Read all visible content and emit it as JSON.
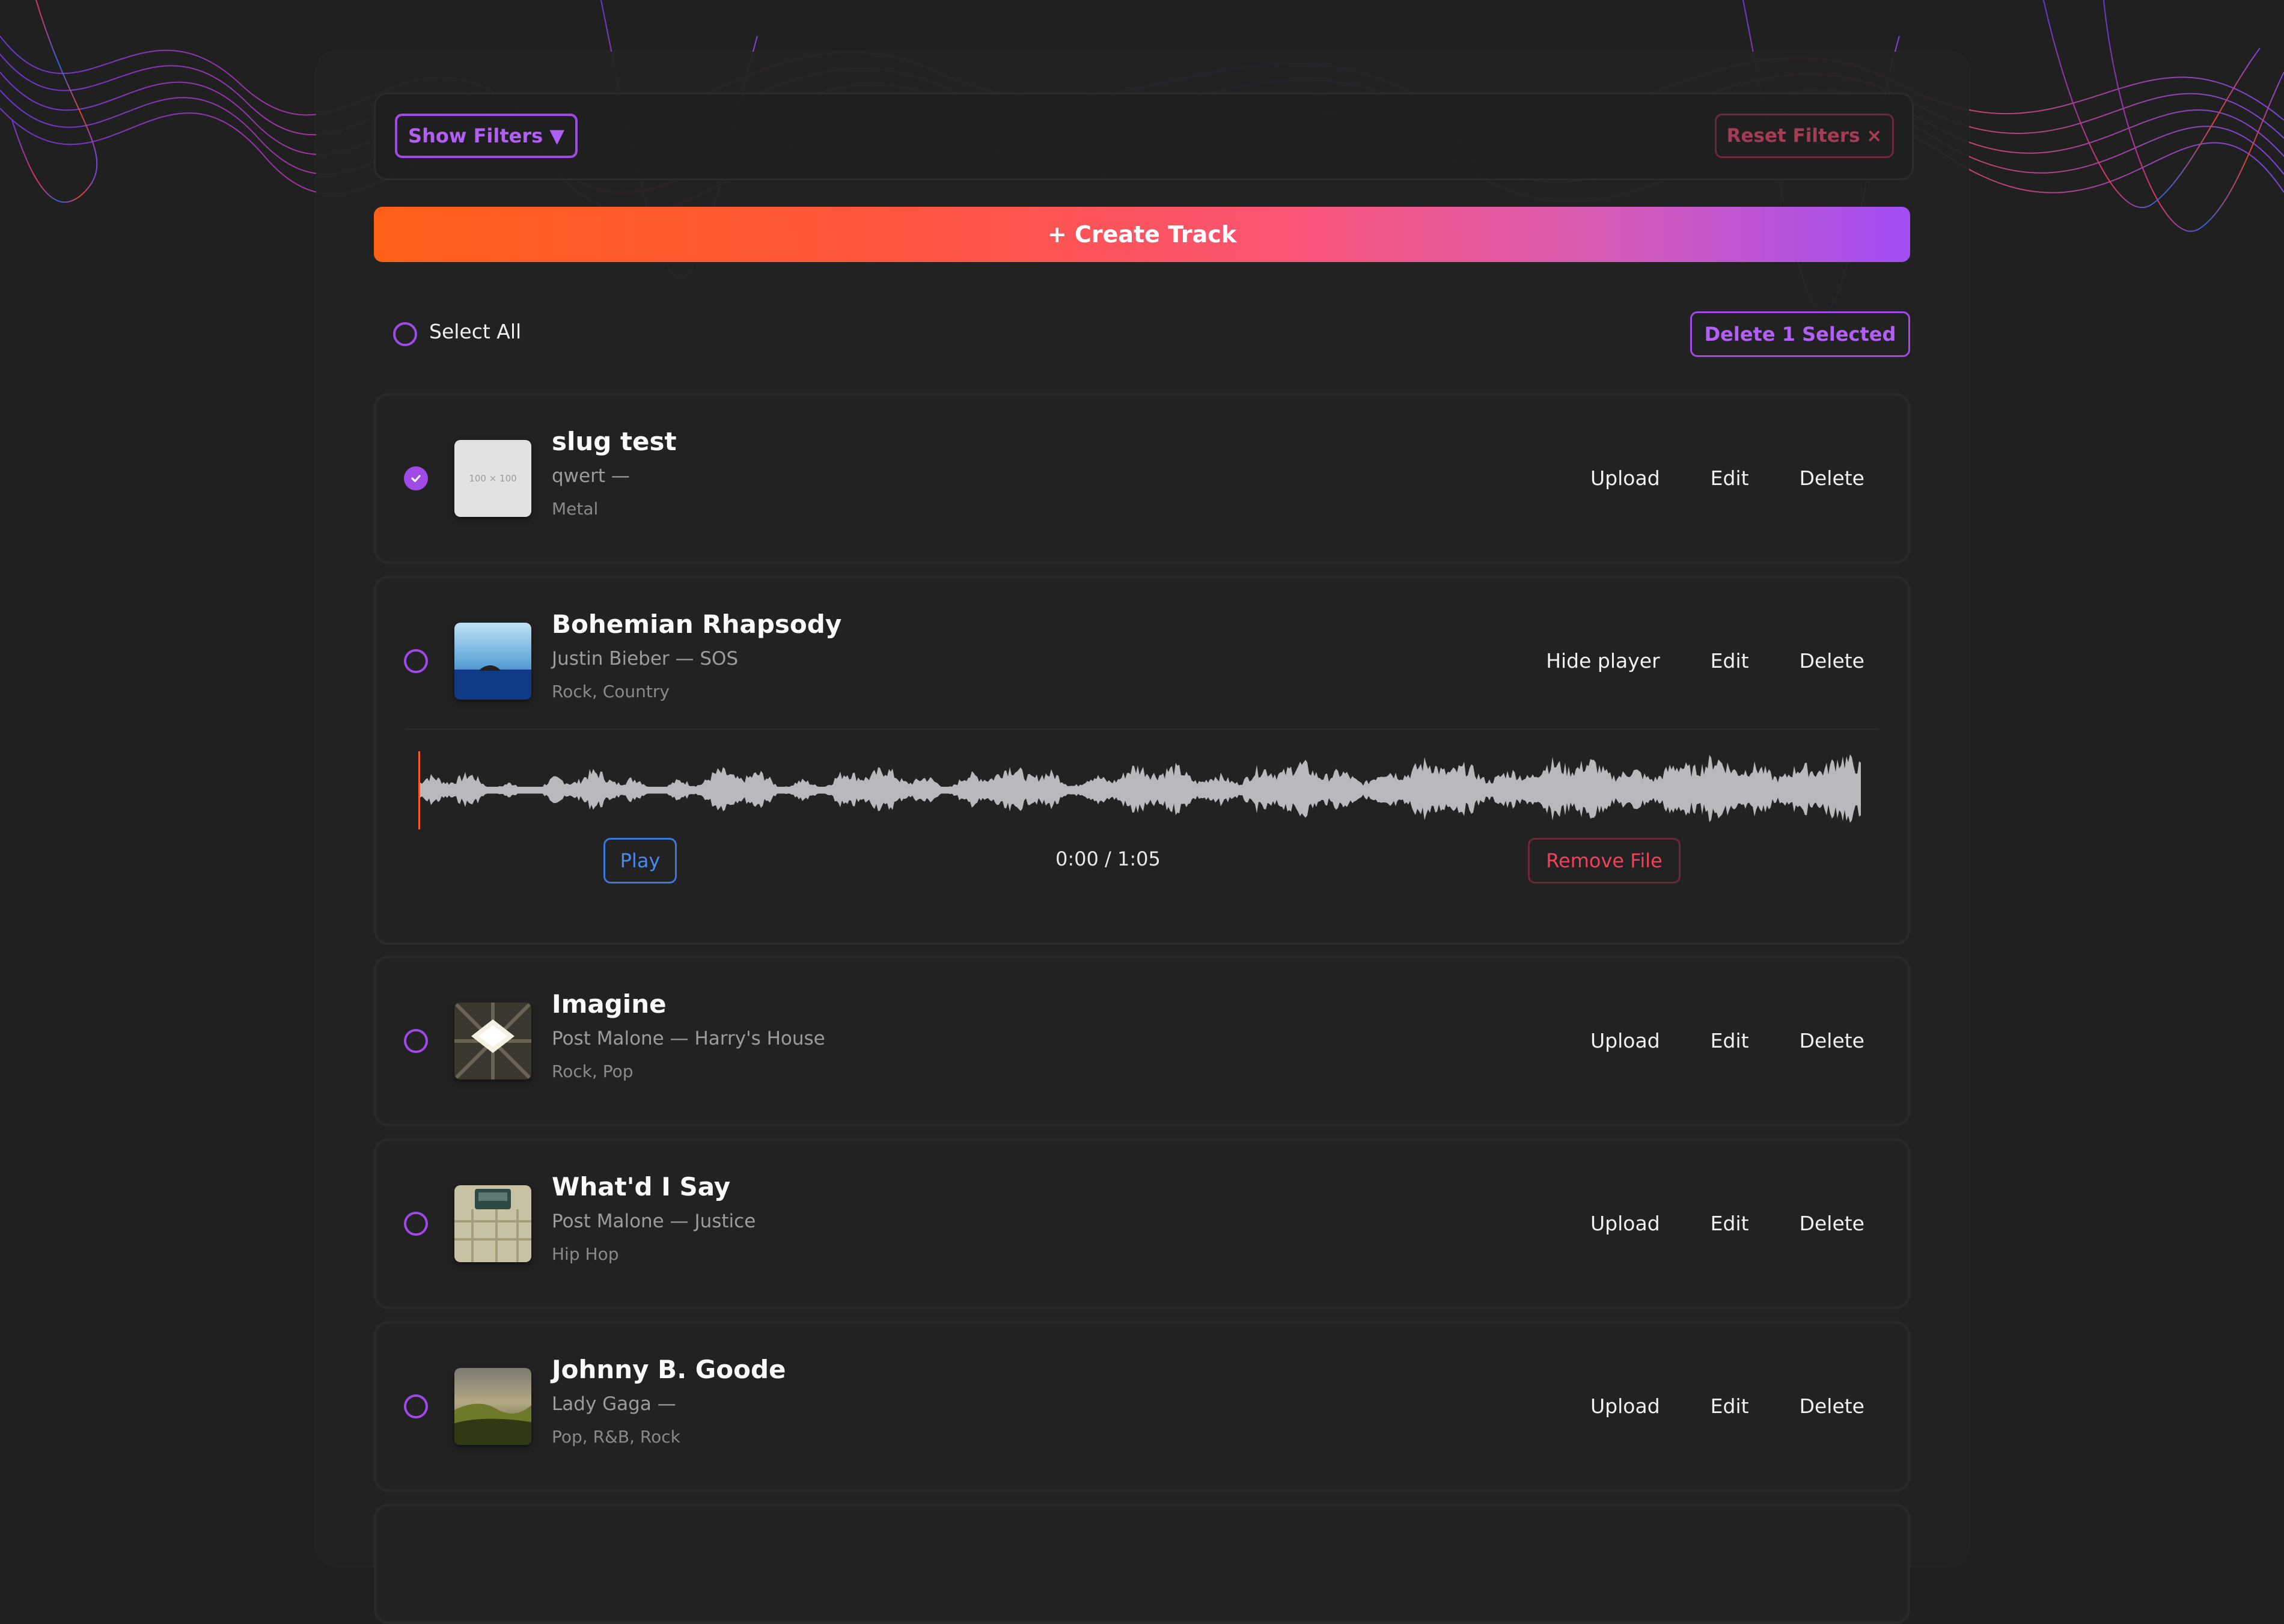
{
  "filters": {
    "show_label": "Show Filters ▼",
    "reset_label": "Reset Filters ×"
  },
  "create_label": "+ Create Track",
  "select_all_label": "Select All",
  "delete_selected_label": "Delete 1 Selected",
  "actions": {
    "upload": "Upload",
    "edit": "Edit",
    "delete": "Delete",
    "hide_player": "Hide player"
  },
  "tracks": [
    {
      "title": "slug test",
      "meta": "qwert —",
      "genres": "Metal",
      "selected": true,
      "cover_text": "100 × 100"
    },
    {
      "title": "Bohemian Rhapsody",
      "meta": "Justin Bieber — SOS",
      "genres": "Rock, Country",
      "selected": false
    },
    {
      "title": "Imagine",
      "meta": "Post Malone — Harry's House",
      "genres": "Rock, Pop",
      "selected": false
    },
    {
      "title": "What'd I Say",
      "meta": "Post Malone — Justice",
      "genres": "Hip Hop",
      "selected": false
    },
    {
      "title": "Johnny B. Goode",
      "meta": "Lady Gaga —",
      "genres": "Pop, R&B, Rock",
      "selected": false
    }
  ],
  "player": {
    "play_label": "Play",
    "time": "0:00 / 1:05",
    "remove_label": "Remove File",
    "progress": 0
  },
  "colors": {
    "accent": "#a04ae8",
    "gradient_start": "#ff6018",
    "gradient_end": "#a14ef5",
    "danger": "#f0415a",
    "play_blue": "#4a88ee"
  }
}
